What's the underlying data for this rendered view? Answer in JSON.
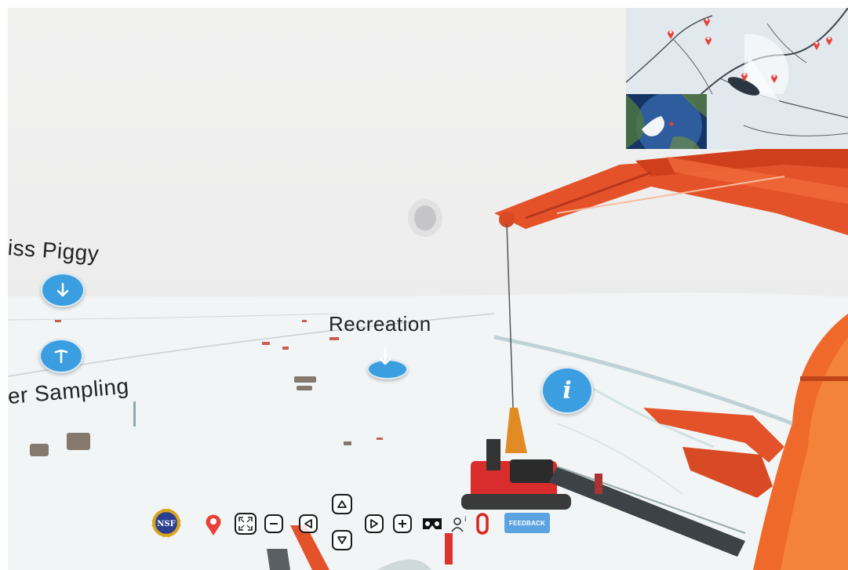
{
  "panorama": {
    "hotspots": [
      {
        "label": "iss Piggy",
        "icon": "arrow-down-icon"
      },
      {
        "label": "er Sampling",
        "icon": "arrow-up-icon"
      },
      {
        "label": "Recreation",
        "icon": "arrow-down-icon"
      }
    ],
    "info_icon_glyph": "i"
  },
  "toolbar": {
    "logo_text": "NSF",
    "buttons": [
      {
        "name": "nsf-logo",
        "icon": "nsf-logo-icon"
      },
      {
        "name": "location-pin-button",
        "icon": "map-pin-icon"
      },
      {
        "name": "fullscreen-button",
        "icon": "fullscreen-icon"
      },
      {
        "name": "zoom-out-button",
        "icon": "minus-icon"
      },
      {
        "name": "pan-left-button",
        "icon": "triangle-left-icon"
      },
      {
        "name": "pan-up-button",
        "icon": "triangle-up-icon"
      },
      {
        "name": "pan-down-button",
        "icon": "triangle-down-icon"
      },
      {
        "name": "pan-right-button",
        "icon": "triangle-right-icon"
      },
      {
        "name": "zoom-in-button",
        "icon": "plus-icon"
      },
      {
        "name": "vr-mode-button",
        "icon": "vr-headset-icon"
      },
      {
        "name": "accessibility-button",
        "icon": "person-info-icon"
      },
      {
        "name": "brand-button",
        "icon": "red-o-icon"
      }
    ],
    "feedback_label": "FEEDBACK"
  },
  "colors": {
    "hotspot_blue": "#3a9ee0",
    "crane_orange": "#e4522a",
    "pin_red": "#e8413a",
    "feedback_blue": "#5aa3e0"
  }
}
